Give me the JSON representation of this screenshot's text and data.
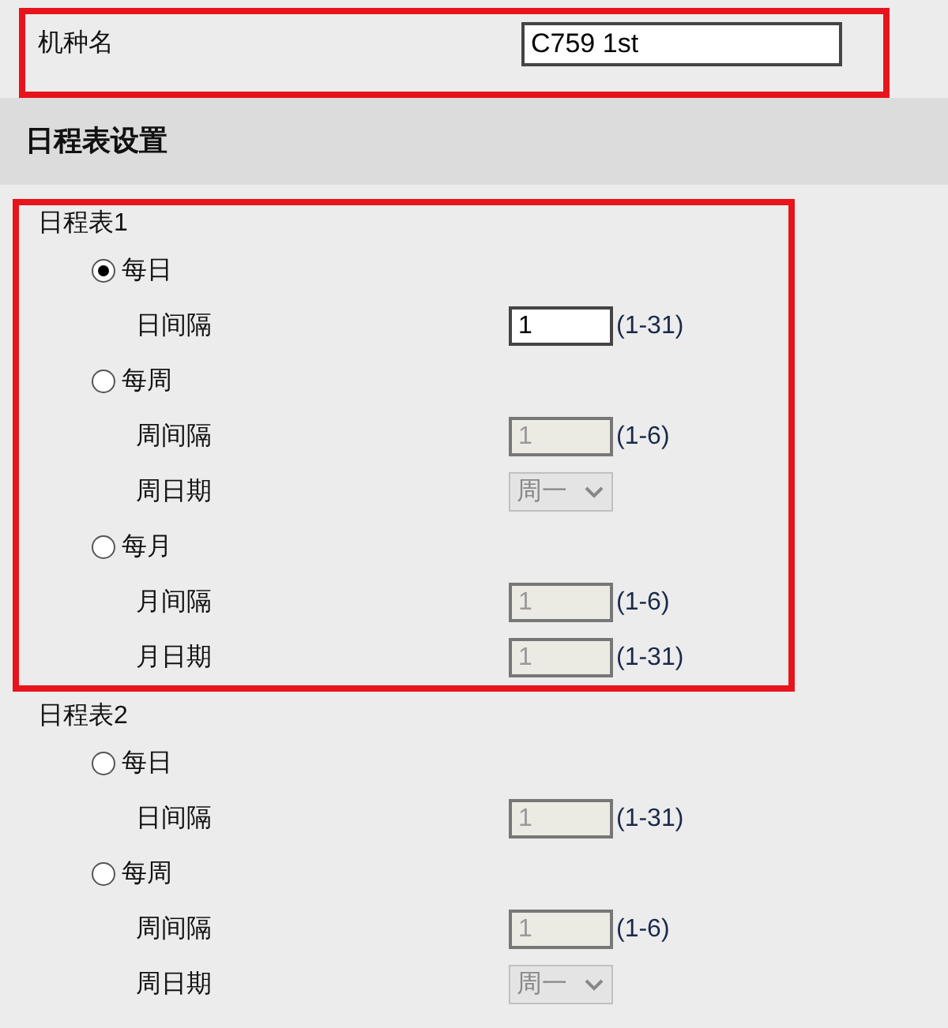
{
  "model_name": {
    "label": "机种名",
    "value": "C759 1st",
    "highlighted": true
  },
  "section_title": "日程表设置",
  "schedules": [
    {
      "title": "日程表1",
      "highlighted": true,
      "options": [
        {
          "label": "每日",
          "selected": true,
          "fields": [
            {
              "kind": "input",
              "label": "日间隔",
              "value": "1",
              "range": "(1-31)",
              "disabled": false
            }
          ]
        },
        {
          "label": "每周",
          "selected": false,
          "fields": [
            {
              "kind": "input",
              "label": "周间隔",
              "value": "1",
              "range": "(1-6)",
              "disabled": true
            },
            {
              "kind": "select",
              "label": "周日期",
              "value": "周一",
              "disabled": true
            }
          ]
        },
        {
          "label": "每月",
          "selected": false,
          "fields": [
            {
              "kind": "input",
              "label": "月间隔",
              "value": "1",
              "range": "(1-6)",
              "disabled": true
            },
            {
              "kind": "input",
              "label": "月日期",
              "value": "1",
              "range": "(1-31)",
              "disabled": true
            }
          ]
        }
      ]
    },
    {
      "title": "日程表2",
      "highlighted": false,
      "options": [
        {
          "label": "每日",
          "selected": false,
          "fields": [
            {
              "kind": "input",
              "label": "日间隔",
              "value": "1",
              "range": "(1-31)",
              "disabled": true
            }
          ]
        },
        {
          "label": "每周",
          "selected": false,
          "fields": [
            {
              "kind": "input",
              "label": "周间隔",
              "value": "1",
              "range": "(1-6)",
              "disabled": true
            },
            {
              "kind": "select",
              "label": "周日期",
              "value": "周一",
              "disabled": true
            }
          ]
        }
      ]
    }
  ]
}
